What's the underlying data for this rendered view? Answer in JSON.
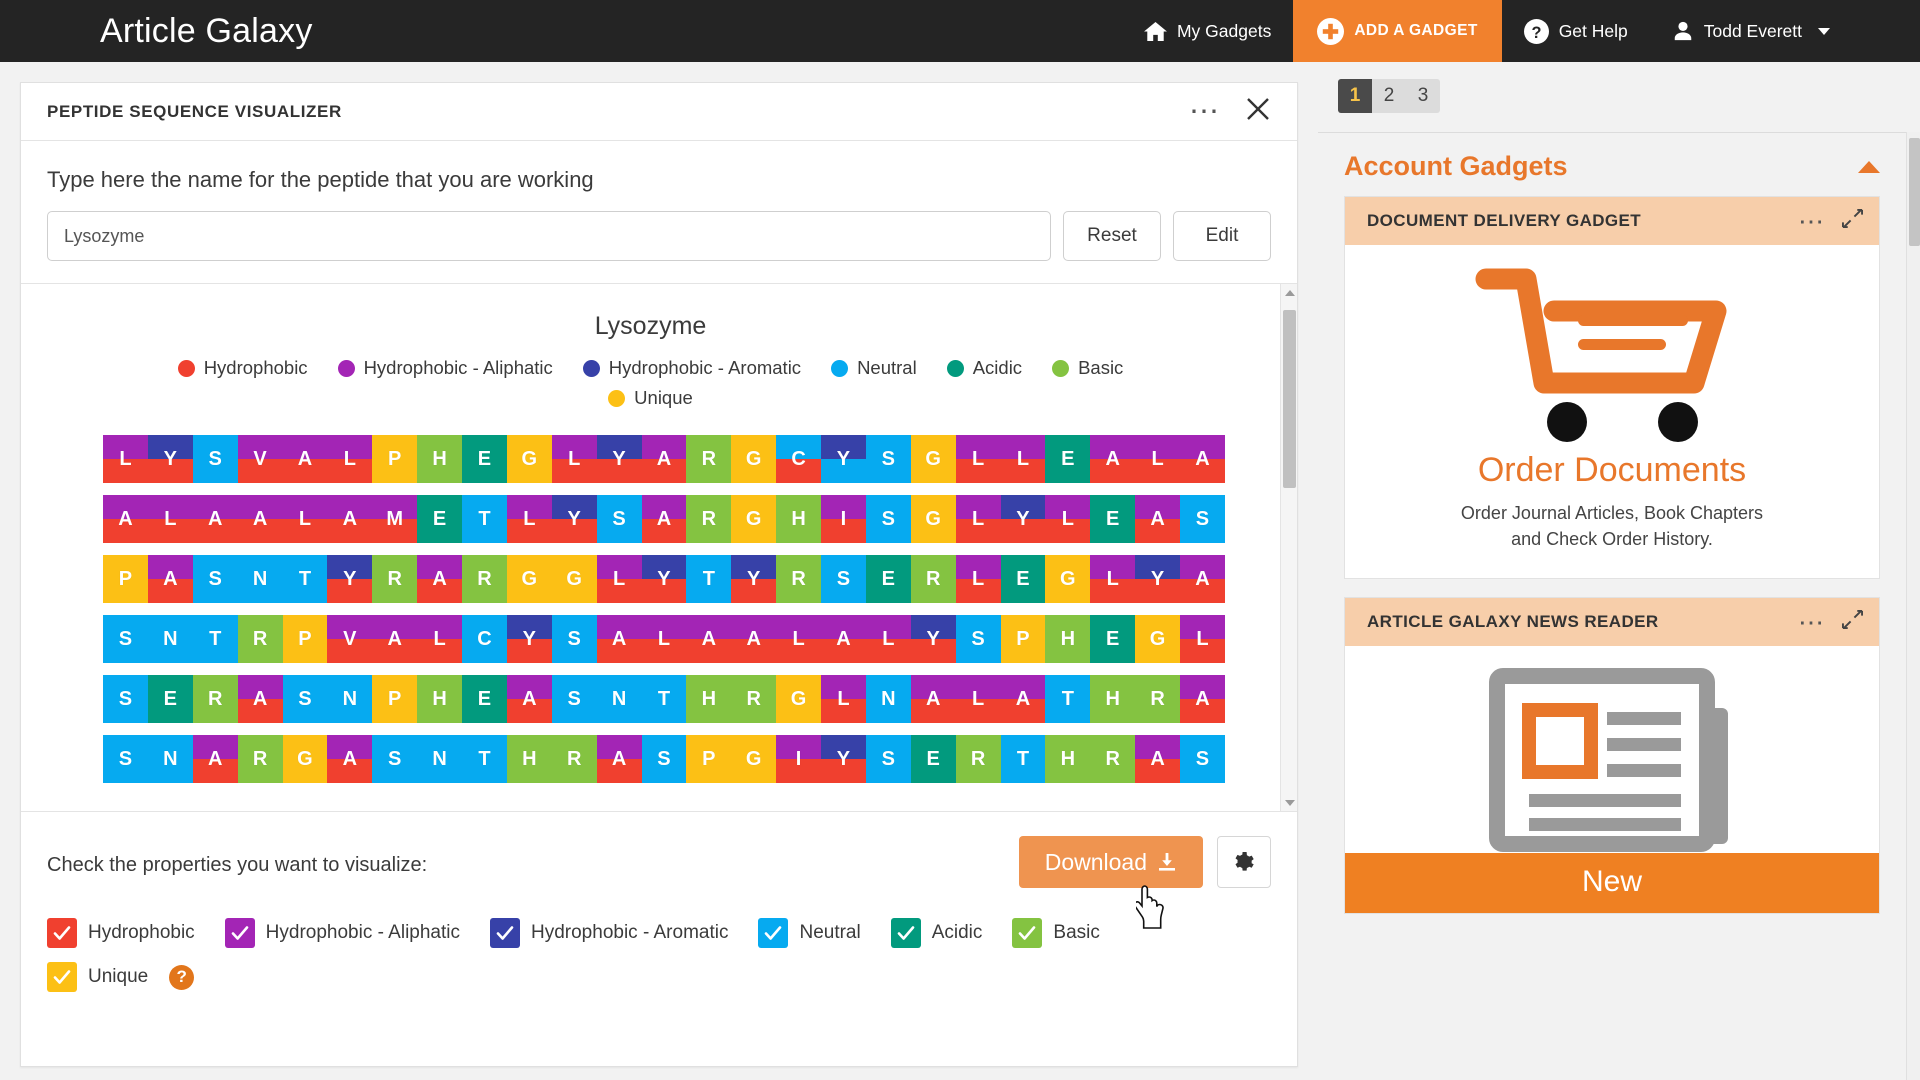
{
  "topnav": {
    "brand": "Article Galaxy",
    "items": [
      {
        "label": "My Gadgets",
        "icon": "home-icon"
      },
      {
        "label": "ADD A GADGET",
        "icon": "plus-circle-icon",
        "highlight": true
      },
      {
        "label": "Get Help",
        "icon": "question-circle-icon"
      },
      {
        "label": "Todd Everett",
        "icon": "user-icon",
        "caret": true
      }
    ]
  },
  "panel": {
    "title": "PEPTIDE SEQUENCE VISUALIZER",
    "more_icon": "more-options-icon",
    "close_icon": "close-icon",
    "name_label": "Type here the name for the peptide that you are working",
    "name_value": "Lysozyme",
    "name_placeholder": "Type here the name for the peptide that you are working",
    "reset_label": "Reset",
    "edit_label": "Edit"
  },
  "viz": {
    "title": "Lysozyme",
    "legend": [
      {
        "label": "Hydrophobic",
        "color": "#f0402f"
      },
      {
        "label": "Hydrophobic - Aliphatic",
        "color": "#a325b5"
      },
      {
        "label": "Hydrophobic - Aromatic",
        "color": "#3741a8"
      },
      {
        "label": "Neutral",
        "color": "#06aaf0"
      },
      {
        "label": "Acidic",
        "color": "#029a7e"
      },
      {
        "label": "Basic",
        "color": "#84c341"
      },
      {
        "label": "Unique",
        "color": "#fcc015"
      }
    ],
    "rows": [
      {
        "letters": [
          "L",
          "Y",
          "S",
          "V",
          "A",
          "L",
          "P",
          "H",
          "E",
          "G",
          "L",
          "Y",
          "A",
          "R",
          "G",
          "C",
          "Y",
          "S",
          "G",
          "L",
          "L",
          "E",
          "A",
          "L",
          "A"
        ],
        "top": [
          "#a325b5",
          "#3741a8",
          "#06aaf0",
          "#a325b5",
          "#a325b5",
          "#a325b5",
          "#fcc015",
          "#84c341",
          "#029a7e",
          "#fcc015",
          "#a325b5",
          "#3741a8",
          "#a325b5",
          "#84c341",
          "#fcc015",
          "#06aaf0",
          "#3741a8",
          "#06aaf0",
          "#fcc015",
          "#a325b5",
          "#a325b5",
          "#029a7e",
          "#a325b5",
          "#a325b5",
          "#a325b5"
        ],
        "bottom": [
          "#f0402f",
          "#f0402f",
          "#06aaf0",
          "#f0402f",
          "#f0402f",
          "#f0402f",
          "#fcc015",
          "#84c341",
          "#029a7e",
          "#fcc015",
          "#f0402f",
          "#f0402f",
          "#f0402f",
          "#84c341",
          "#fcc015",
          "#f0402f",
          "#06aaf0",
          "#06aaf0",
          "#fcc015",
          "#f0402f",
          "#f0402f",
          "#029a7e",
          "#f0402f",
          "#f0402f",
          "#f0402f"
        ]
      },
      {
        "letters": [
          "A",
          "L",
          "A",
          "A",
          "L",
          "A",
          "M",
          "E",
          "T",
          "L",
          "Y",
          "S",
          "A",
          "R",
          "G",
          "H",
          "I",
          "S",
          "G",
          "L",
          "Y",
          "L",
          "E",
          "A",
          "S"
        ],
        "top": [
          "#a325b5",
          "#a325b5",
          "#a325b5",
          "#a325b5",
          "#a325b5",
          "#a325b5",
          "#a325b5",
          "#029a7e",
          "#06aaf0",
          "#a325b5",
          "#3741a8",
          "#06aaf0",
          "#a325b5",
          "#84c341",
          "#fcc015",
          "#84c341",
          "#a325b5",
          "#06aaf0",
          "#fcc015",
          "#a325b5",
          "#3741a8",
          "#a325b5",
          "#029a7e",
          "#a325b5",
          "#06aaf0"
        ],
        "bottom": [
          "#f0402f",
          "#f0402f",
          "#f0402f",
          "#f0402f",
          "#f0402f",
          "#f0402f",
          "#f0402f",
          "#029a7e",
          "#06aaf0",
          "#f0402f",
          "#f0402f",
          "#06aaf0",
          "#f0402f",
          "#84c341",
          "#fcc015",
          "#84c341",
          "#f0402f",
          "#06aaf0",
          "#fcc015",
          "#f0402f",
          "#f0402f",
          "#f0402f",
          "#029a7e",
          "#f0402f",
          "#06aaf0"
        ]
      },
      {
        "letters": [
          "P",
          "A",
          "S",
          "N",
          "T",
          "Y",
          "R",
          "A",
          "R",
          "G",
          "G",
          "L",
          "Y",
          "T",
          "Y",
          "R",
          "S",
          "E",
          "R",
          "L",
          "E",
          "G",
          "L",
          "Y",
          "A"
        ],
        "top": [
          "#fcc015",
          "#a325b5",
          "#06aaf0",
          "#06aaf0",
          "#06aaf0",
          "#3741a8",
          "#84c341",
          "#a325b5",
          "#84c341",
          "#fcc015",
          "#fcc015",
          "#a325b5",
          "#3741a8",
          "#06aaf0",
          "#3741a8",
          "#84c341",
          "#06aaf0",
          "#029a7e",
          "#84c341",
          "#a325b5",
          "#029a7e",
          "#fcc015",
          "#a325b5",
          "#3741a8",
          "#a325b5"
        ],
        "bottom": [
          "#fcc015",
          "#f0402f",
          "#06aaf0",
          "#06aaf0",
          "#06aaf0",
          "#f0402f",
          "#84c341",
          "#f0402f",
          "#84c341",
          "#fcc015",
          "#fcc015",
          "#f0402f",
          "#f0402f",
          "#06aaf0",
          "#f0402f",
          "#84c341",
          "#06aaf0",
          "#029a7e",
          "#84c341",
          "#f0402f",
          "#029a7e",
          "#fcc015",
          "#f0402f",
          "#f0402f",
          "#f0402f"
        ]
      },
      {
        "letters": [
          "S",
          "N",
          "T",
          "R",
          "P",
          "V",
          "A",
          "L",
          "C",
          "Y",
          "S",
          "A",
          "L",
          "A",
          "A",
          "L",
          "A",
          "L",
          "Y",
          "S",
          "P",
          "H",
          "E",
          "G",
          "L"
        ],
        "top": [
          "#06aaf0",
          "#06aaf0",
          "#06aaf0",
          "#84c341",
          "#fcc015",
          "#a325b5",
          "#a325b5",
          "#a325b5",
          "#06aaf0",
          "#3741a8",
          "#06aaf0",
          "#a325b5",
          "#a325b5",
          "#a325b5",
          "#a325b5",
          "#a325b5",
          "#a325b5",
          "#a325b5",
          "#3741a8",
          "#06aaf0",
          "#fcc015",
          "#84c341",
          "#029a7e",
          "#fcc015",
          "#a325b5"
        ],
        "bottom": [
          "#06aaf0",
          "#06aaf0",
          "#06aaf0",
          "#84c341",
          "#fcc015",
          "#f0402f",
          "#f0402f",
          "#f0402f",
          "#06aaf0",
          "#f0402f",
          "#06aaf0",
          "#f0402f",
          "#f0402f",
          "#f0402f",
          "#f0402f",
          "#f0402f",
          "#f0402f",
          "#f0402f",
          "#f0402f",
          "#06aaf0",
          "#fcc015",
          "#84c341",
          "#029a7e",
          "#fcc015",
          "#f0402f"
        ]
      },
      {
        "letters": [
          "S",
          "E",
          "R",
          "A",
          "S",
          "N",
          "P",
          "H",
          "E",
          "A",
          "S",
          "N",
          "T",
          "H",
          "R",
          "G",
          "L",
          "N",
          "A",
          "L",
          "A",
          "T",
          "H",
          "R",
          "A"
        ],
        "top": [
          "#06aaf0",
          "#029a7e",
          "#84c341",
          "#a325b5",
          "#06aaf0",
          "#06aaf0",
          "#fcc015",
          "#84c341",
          "#029a7e",
          "#a325b5",
          "#06aaf0",
          "#06aaf0",
          "#06aaf0",
          "#84c341",
          "#84c341",
          "#fcc015",
          "#a325b5",
          "#06aaf0",
          "#a325b5",
          "#a325b5",
          "#a325b5",
          "#06aaf0",
          "#84c341",
          "#84c341",
          "#a325b5"
        ],
        "bottom": [
          "#06aaf0",
          "#029a7e",
          "#84c341",
          "#f0402f",
          "#06aaf0",
          "#06aaf0",
          "#fcc015",
          "#84c341",
          "#029a7e",
          "#f0402f",
          "#06aaf0",
          "#06aaf0",
          "#06aaf0",
          "#84c341",
          "#84c341",
          "#fcc015",
          "#f0402f",
          "#06aaf0",
          "#f0402f",
          "#f0402f",
          "#f0402f",
          "#06aaf0",
          "#84c341",
          "#84c341",
          "#f0402f"
        ]
      },
      {
        "letters": [
          "S",
          "N",
          "A",
          "R",
          "G",
          "A",
          "S",
          "N",
          "T",
          "H",
          "R",
          "A",
          "S",
          "P",
          "G",
          "I",
          "Y",
          "S",
          "E",
          "R",
          "T",
          "H",
          "R",
          "A",
          "S"
        ],
        "top": [
          "#06aaf0",
          "#06aaf0",
          "#a325b5",
          "#84c341",
          "#fcc015",
          "#a325b5",
          "#06aaf0",
          "#06aaf0",
          "#06aaf0",
          "#84c341",
          "#84c341",
          "#a325b5",
          "#06aaf0",
          "#fcc015",
          "#fcc015",
          "#a325b5",
          "#3741a8",
          "#06aaf0",
          "#029a7e",
          "#84c341",
          "#06aaf0",
          "#84c341",
          "#84c341",
          "#a325b5",
          "#06aaf0"
        ],
        "bottom": [
          "#06aaf0",
          "#06aaf0",
          "#f0402f",
          "#84c341",
          "#fcc015",
          "#f0402f",
          "#06aaf0",
          "#06aaf0",
          "#06aaf0",
          "#84c341",
          "#84c341",
          "#f0402f",
          "#06aaf0",
          "#fcc015",
          "#fcc015",
          "#f0402f",
          "#f0402f",
          "#06aaf0",
          "#029a7e",
          "#84c341",
          "#06aaf0",
          "#84c341",
          "#84c341",
          "#f0402f",
          "#06aaf0"
        ]
      }
    ]
  },
  "controls": {
    "label": "Check the properties you want to visualize:",
    "download_label": "Download",
    "download_icon": "download-icon",
    "settings_icon": "gear-icon",
    "help_icon": "question-mark-icon",
    "help_glyph": "?",
    "checkboxes": [
      {
        "label": "Hydrophobic",
        "color": "#f0402f",
        "checked": true
      },
      {
        "label": "Hydrophobic - Aliphatic",
        "color": "#a325b5",
        "checked": true
      },
      {
        "label": "Hydrophobic - Aromatic",
        "color": "#3741a8",
        "checked": true
      },
      {
        "label": "Neutral",
        "color": "#06aaf0",
        "checked": true
      },
      {
        "label": "Acidic",
        "color": "#029a7e",
        "checked": true
      },
      {
        "label": "Basic",
        "color": "#84c341",
        "checked": true
      },
      {
        "label": "Unique",
        "color": "#fcc015",
        "checked": true
      }
    ]
  },
  "sidebar": {
    "pager": [
      "1",
      "2",
      "3"
    ],
    "pager_active": "1",
    "section_title": "Account Gadgets",
    "gadgets": [
      {
        "title": "DOCUMENT DELIVERY GADGET",
        "icon": "shopping-cart-icon",
        "heading": "Order Documents",
        "subtext_line1": "Order Journal Articles, Book Chapters",
        "subtext_line2": "and Check Order History."
      },
      {
        "title": "ARTICLE GALAXY NEWS READER",
        "icon": "newspaper-icon",
        "banner": "New"
      }
    ]
  },
  "colors": {
    "brand_orange": "#ef8022",
    "nav_dark": "#242424",
    "page_bg": "#f2f2f2"
  }
}
